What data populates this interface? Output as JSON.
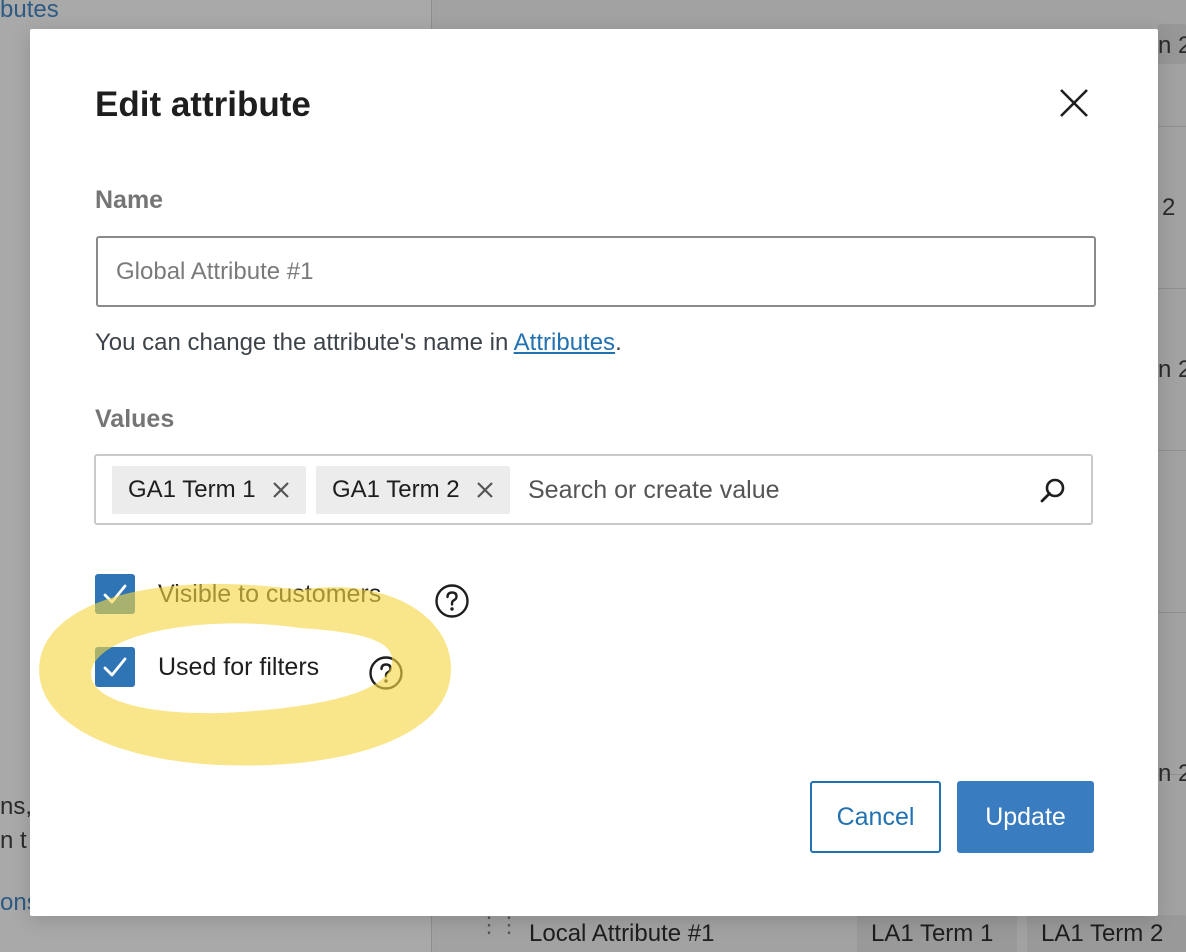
{
  "background": {
    "top_link_fragment": "butes",
    "left_fragments": [
      "ns,",
      "n t"
    ],
    "left_link_fragment": "ons",
    "right_chip_fragments": [
      "n 2",
      "2",
      "n 2",
      "n 2"
    ],
    "bottom_row": {
      "attribute_name": "Local Attribute #1",
      "terms": [
        "LA1 Term 1",
        "LA1 Term 2"
      ]
    }
  },
  "modal": {
    "title": "Edit attribute",
    "name_label": "Name",
    "name_placeholder": "Global Attribute #1",
    "help_prefix": "You can change the attribute's name in ",
    "help_link": "Attributes",
    "help_suffix": ".",
    "values_label": "Values",
    "value_chips": [
      {
        "label": "GA1 Term 1"
      },
      {
        "label": "GA1 Term 2"
      }
    ],
    "search_placeholder": "Search or create value",
    "checkboxes": [
      {
        "label": "Visible to customers",
        "checked": true
      },
      {
        "label": "Used for filters",
        "checked": true
      }
    ],
    "cancel_label": "Cancel",
    "update_label": "Update"
  },
  "colors": {
    "accent": "#2271b1",
    "checkbox": "#2f74b5",
    "update_button": "#3a7cc0",
    "highlight": "#f5d742"
  }
}
